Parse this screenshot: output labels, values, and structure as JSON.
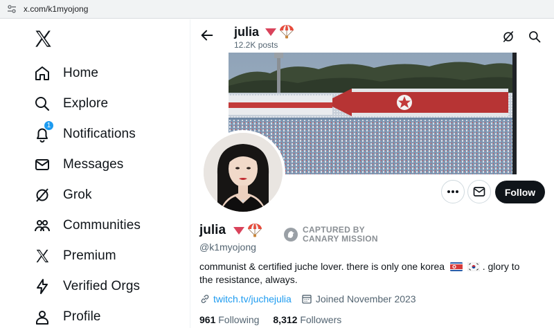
{
  "browser": {
    "url": "x.com/k1myojong"
  },
  "sidebar": {
    "items": [
      {
        "label": "Home",
        "icon": "home-icon"
      },
      {
        "label": "Explore",
        "icon": "search-icon"
      },
      {
        "label": "Notifications",
        "icon": "bell-icon",
        "badge": "1"
      },
      {
        "label": "Messages",
        "icon": "envelope-icon"
      },
      {
        "label": "Grok",
        "icon": "grok-icon"
      },
      {
        "label": "Communities",
        "icon": "people-icon"
      },
      {
        "label": "Premium",
        "icon": "x-logo-icon"
      },
      {
        "label": "Verified Orgs",
        "icon": "lightning-icon"
      },
      {
        "label": "Profile",
        "icon": "person-icon"
      }
    ]
  },
  "header": {
    "name": "julia",
    "posts": "12.2K posts"
  },
  "profile": {
    "name": "julia",
    "handle": "@k1myojong",
    "captured": [
      "CAPTURED BY",
      "CANARY MISSION"
    ],
    "bio_before": "communist & certified juche lover. there is only one korea",
    "bio_after": ". glory to the resistance, always.",
    "link": "twitch.tv/juchejulia",
    "joined": "Joined November 2023",
    "following_count": "961",
    "following_label": "Following",
    "followers_count": "8,312",
    "followers_label": "Followers",
    "follow_button": "Follow"
  },
  "colors": {
    "accent": "#1d9bf0",
    "text": "#0f1419",
    "muted": "#536471"
  }
}
